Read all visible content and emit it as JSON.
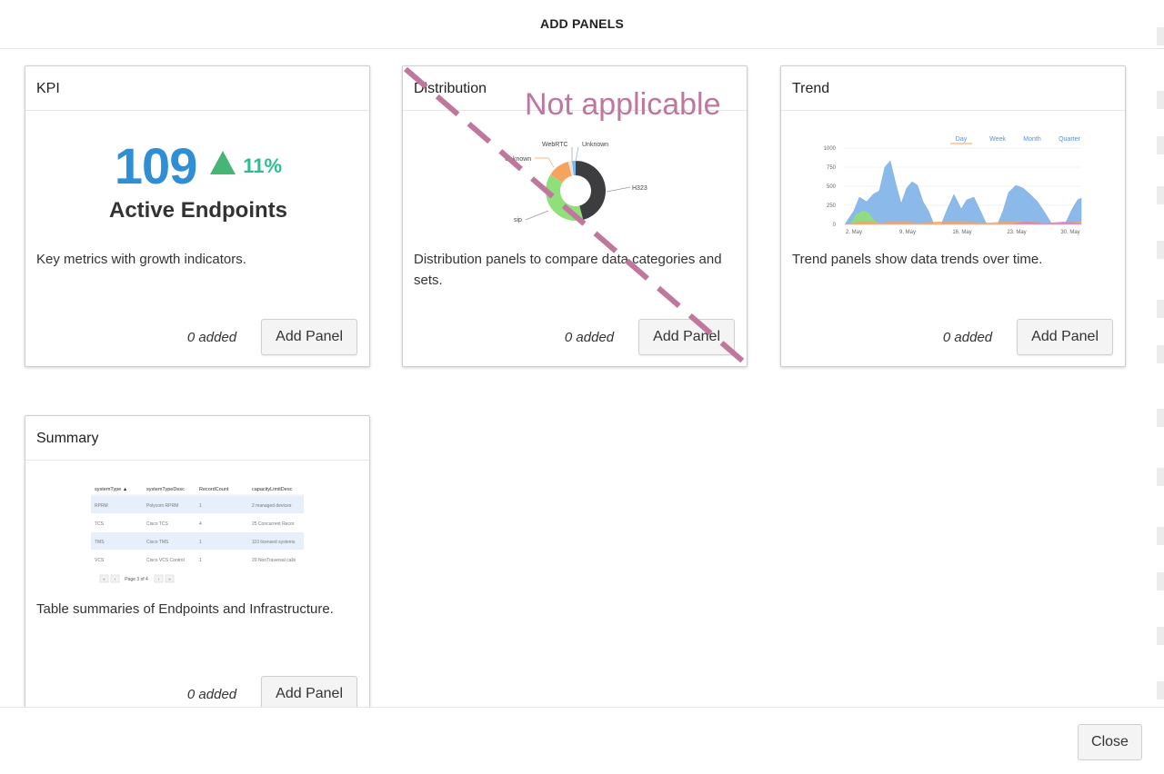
{
  "modal": {
    "title": "ADD PANELS",
    "close_label": "Close"
  },
  "cards": [
    {
      "title": "KPI",
      "description": "Key metrics with growth indicators.",
      "added": "0 added",
      "button": "Add Panel"
    },
    {
      "title": "Distribution",
      "description": "Distribution panels to compare data categories and sets.",
      "added": "0 added",
      "button": "Add Panel"
    },
    {
      "title": "Trend",
      "description": "Trend panels show data trends over time.",
      "added": "0 added",
      "button": "Add Panel"
    },
    {
      "title": "Summary",
      "description": "Table summaries of Endpoints and Infrastructure.",
      "added": "0 added",
      "button": "Add Panel"
    }
  ],
  "kpi_preview": {
    "value": "109",
    "change": "11%",
    "label": "Active Endpoints",
    "trend": "up",
    "value_color": "#2f8fd6",
    "arrow_color": "#46b575"
  },
  "distribution_preview": {
    "segments": [
      {
        "label": "H323",
        "value": 46,
        "color": "#3d3d3f"
      },
      {
        "label": "sip",
        "value": 38,
        "color": "#8fe07a"
      },
      {
        "label": "Unknown",
        "value": 12,
        "color": "#f6a360"
      },
      {
        "label": "WebRTC",
        "value": 2,
        "color": "#e5e5e5"
      },
      {
        "label": "Unknown",
        "value": 2,
        "color": "#7fb5e8"
      }
    ]
  },
  "trend_preview": {
    "tabs": [
      "Day",
      "Week",
      "Month",
      "Quarter"
    ],
    "active_tab": "Day",
    "y_ticks": [
      "1000",
      "750",
      "500",
      "250",
      "0"
    ],
    "x_ticks": [
      "2. May",
      "9. May",
      "16. May",
      "23. May",
      "30. May"
    ]
  },
  "summary_preview": {
    "columns": [
      "systemType ▲",
      "systemTypeDesc",
      "RecordCount",
      "capacityLimitDesc"
    ],
    "rows": [
      [
        "RPRM",
        "Polycom RPRM",
        "1",
        "2 managed devices"
      ],
      [
        "TCS",
        "Cisco TCS",
        "4",
        "25 Concurrent Recor"
      ],
      [
        "TMS",
        "Cisco TMS",
        "1",
        "110 licensed systems"
      ],
      [
        "VCS",
        "Cisco VCS Control",
        "1",
        "20 NonTraversal calls"
      ]
    ],
    "pager": "Page 3 of 4"
  },
  "overlay": {
    "text": "Not applicable",
    "color": "#c0779e"
  }
}
